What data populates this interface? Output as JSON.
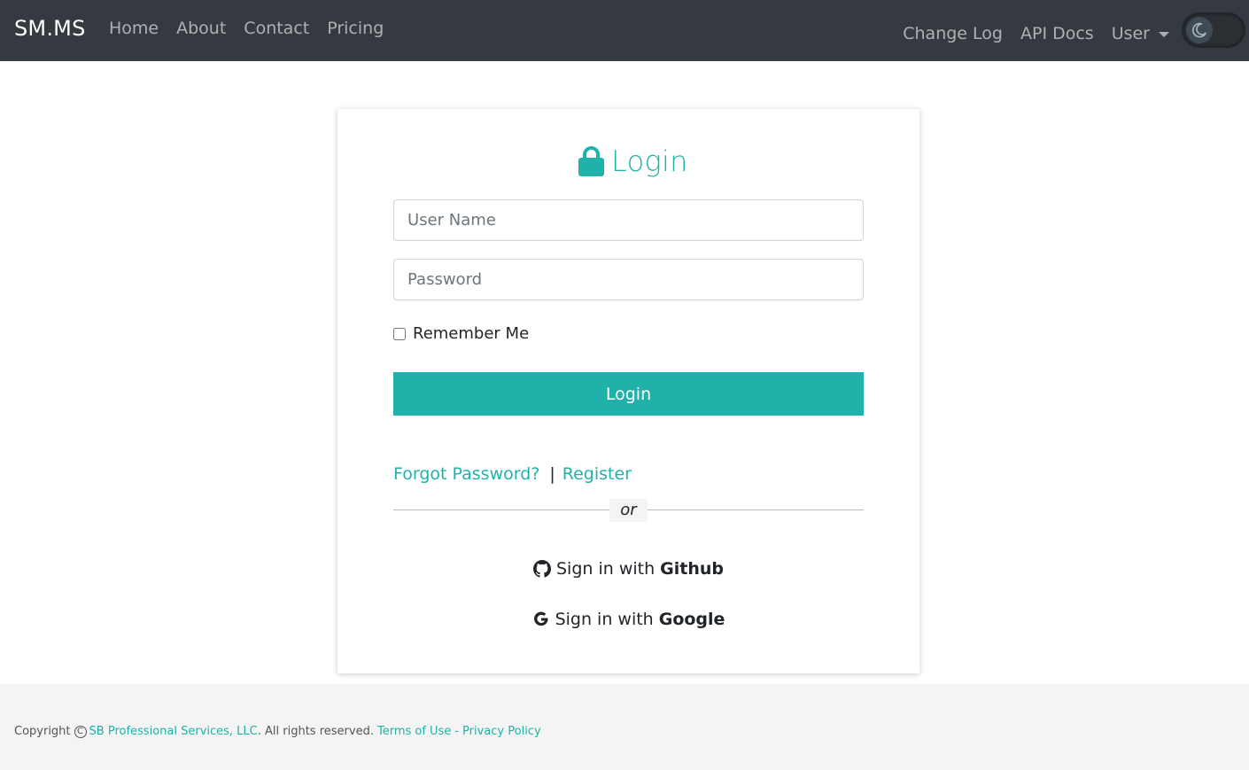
{
  "navbar": {
    "brand": "SM.MS",
    "left_links": [
      "Home",
      "About",
      "Contact",
      "Pricing"
    ],
    "right_links": [
      "Change Log",
      "API Docs"
    ],
    "user_menu": "User",
    "theme_toggle_icon": "moon-icon"
  },
  "login": {
    "title": "Login",
    "title_icon": "lock-icon",
    "username_placeholder": "User Name",
    "password_placeholder": "Password",
    "remember_label": "Remember Me",
    "remember_checked": false,
    "submit_label": "Login",
    "forgot_label": "Forgot Password?",
    "separator": "|",
    "register_label": "Register",
    "or_label": "or",
    "github": {
      "prefix": "Sign in with",
      "provider": "Github",
      "icon": "github-icon"
    },
    "google": {
      "prefix": "Sign in with",
      "provider": "Google",
      "icon": "google-icon"
    }
  },
  "footer": {
    "copyright_label": "Copyright",
    "copyright_symbol": "C",
    "company": "SB Professional Services, LLC",
    "rights": ". All rights reserved.",
    "terms": "Terms of Use",
    "dash": "-",
    "privacy": "Privacy Policy"
  },
  "colors": {
    "accent": "#20b2aa",
    "navbar_bg": "#343a40",
    "footer_bg": "#f4f4f4"
  }
}
